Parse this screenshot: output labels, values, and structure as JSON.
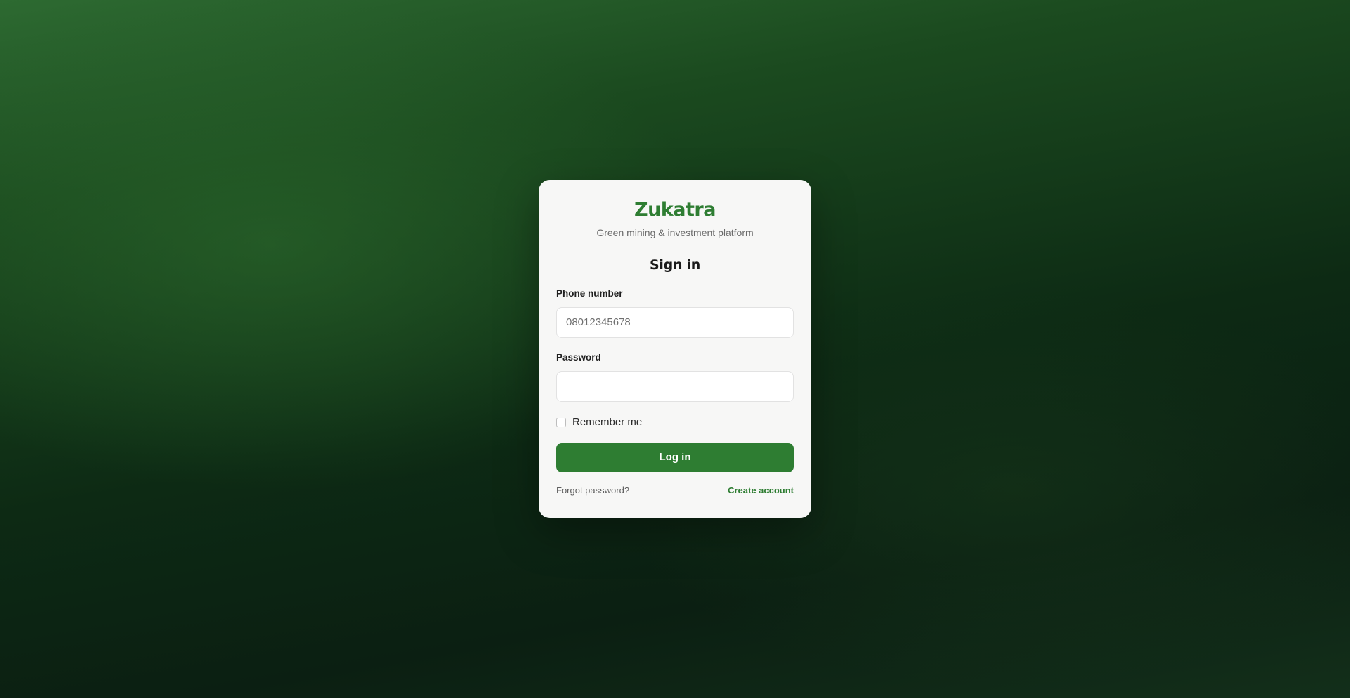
{
  "brand": {
    "name": "Zukatra",
    "tagline": "Green mining & investment platform"
  },
  "form": {
    "title": "Sign in",
    "phone_label": "Phone number",
    "phone_placeholder": "08012345678",
    "phone_value": "",
    "password_label": "Password",
    "password_value": "",
    "remember_label": "Remember me",
    "remember_checked": false,
    "submit_label": "Log in",
    "forgot_label": "Forgot password?",
    "create_label": "Create account"
  },
  "colors": {
    "accent": "#2e7d32",
    "card_background": "#f7f7f6",
    "page_background_top": "#2d6a31",
    "page_background_bottom": "#0b1f12"
  }
}
